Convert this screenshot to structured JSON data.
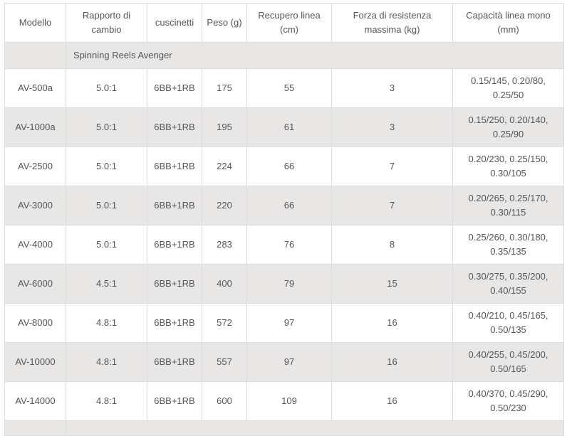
{
  "table": {
    "headers": [
      "Modello",
      "Rapporto di cambio",
      "cuscinetti",
      "Peso (g)",
      "Recupero linea (cm)",
      "Forza di resistenza massima (kg)",
      "Capacità linea mono (mm)"
    ],
    "group_label": "Spinning Reels Avenger",
    "rows": [
      [
        "AV-500a",
        "5.0:1",
        "6BB+1RB",
        "175",
        "55",
        "3",
        "0.15/145, 0.20/80, 0.25/50"
      ],
      [
        "AV-1000a",
        "5.0:1",
        "6BB+1RB",
        "195",
        "61",
        "3",
        "0.15/250, 0.20/140, 0.25/90"
      ],
      [
        "AV-2500",
        "5.0:1",
        "6BB+1RB",
        "224",
        "66",
        "7",
        "0.20/230, 0.25/150, 0.30/105"
      ],
      [
        "AV-3000",
        "5.0:1",
        "6BB+1RB",
        "220",
        "66",
        "7",
        "0.20/265, 0.25/170, 0.30/115"
      ],
      [
        "AV-4000",
        "5.0:1",
        "6BB+1RB",
        "283",
        "76",
        "8",
        "0.25/260, 0.30/180, 0.35/135"
      ],
      [
        "AV-6000",
        "4.5:1",
        "6BB+1RB",
        "400",
        "79",
        "15",
        "0.30/275, 0.35/200, 0.40/155"
      ],
      [
        "AV-8000",
        "4.8:1",
        "6BB+1RB",
        "572",
        "97",
        "16",
        "0.40/210, 0.45/165, 0.50/135"
      ],
      [
        "AV-10000",
        "4.8:1",
        "6BB+1RB",
        "557",
        "97",
        "16",
        "0.40/255, 0.45/200, 0.50/165"
      ],
      [
        "AV-14000",
        "4.8:1",
        "6BB+1RB",
        "600",
        "109",
        "16",
        "0.40/370, 0.45/290, 0.50/230"
      ]
    ]
  },
  "colors": {
    "stripe": "#e9e6e6",
    "border": "#dcdcdc",
    "text": "#555555"
  }
}
